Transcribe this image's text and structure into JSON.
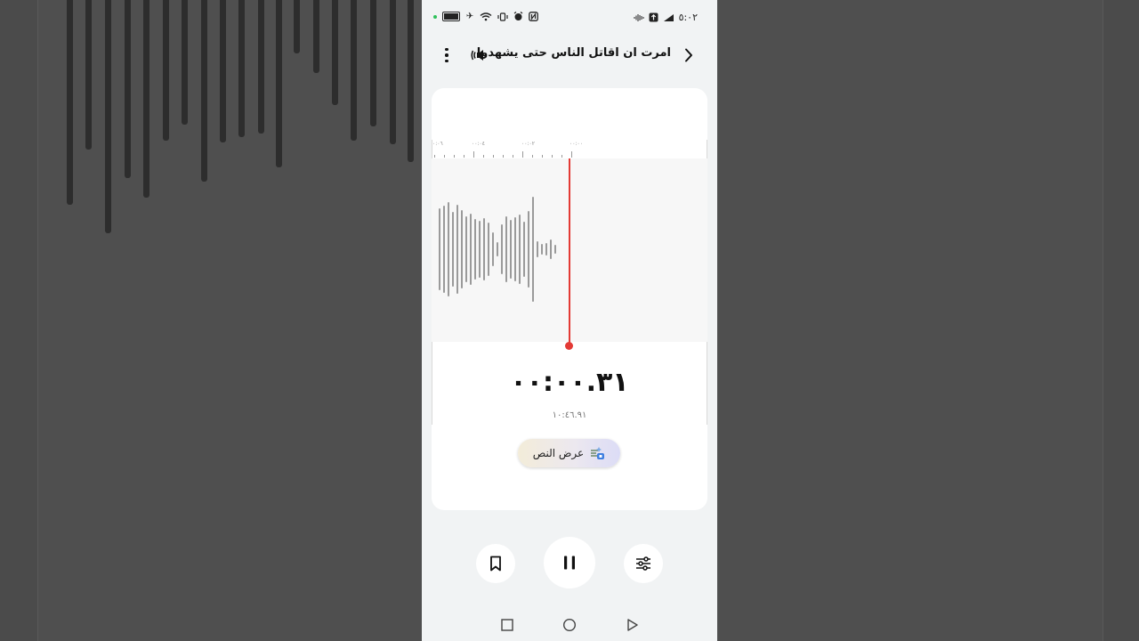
{
  "status_bar": {
    "time": "٥:٠٢"
  },
  "header": {
    "title": "امرت ان اقاتل الناس حتى يشهدوا",
    "back_icon": "chevron-right-icon",
    "speaker_icon": "speaker-icon",
    "more_icon": "more-vertical-icon"
  },
  "ruler": {
    "labels": [
      "٠:٠٦",
      "٠٠:٠٤",
      "٠٠:٠٢",
      "٠٠:٠٠"
    ]
  },
  "recording": {
    "elapsed": "٠٠:٠٠.٣١",
    "total": "١٠:٤٦.٩١",
    "progress_fraction": 0.0005
  },
  "transcript_button": {
    "label": "عرض النص",
    "icon": "ai-transcript-icon"
  },
  "controls": {
    "bookmark_icon": "bookmark-icon",
    "pause_icon": "pause-icon",
    "settings_icon": "sliders-icon"
  },
  "nav": {
    "recents_icon": "square-icon",
    "home_icon": "circle-icon",
    "back_icon": "triangle-back-icon"
  },
  "colors": {
    "accent": "#e33a35",
    "background": "#f1f3f4",
    "card": "#ffffff"
  }
}
